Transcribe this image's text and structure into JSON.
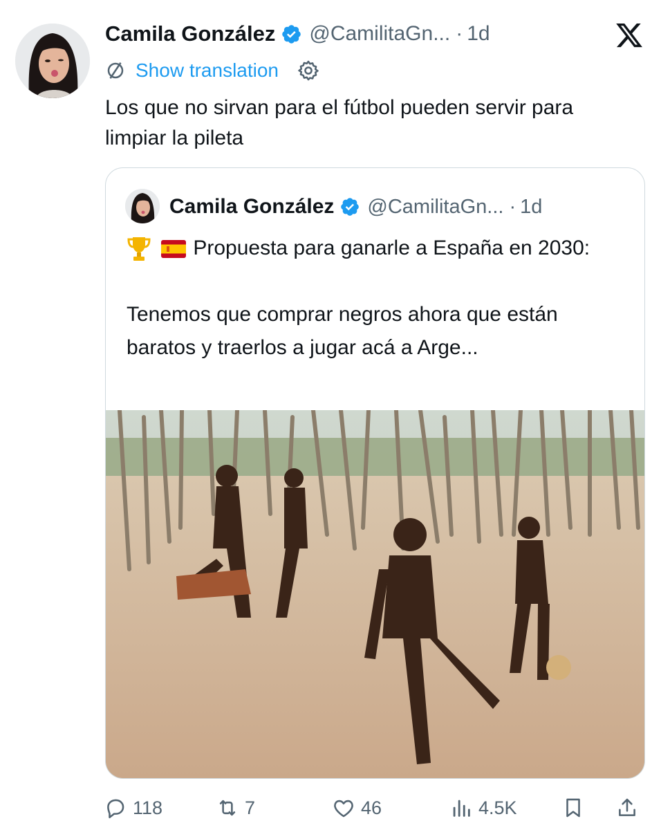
{
  "tweet": {
    "author_name": "Camila González",
    "handle": "@CamilitaGn...",
    "separator": "·",
    "time": "1d",
    "translate_label": "Show translation",
    "text": "Los que no sirvan para el fútbol pueden servir para limpiar la pileta"
  },
  "quoted": {
    "author_name": "Camila González",
    "handle": "@CamilitaGn...",
    "separator": "·",
    "time": "1d",
    "text_line1": "Propuesta para ganarle a España en 2030:",
    "text_line2": "Tenemos que comprar negros ahora que están baratos y traerlos a jugar acá a Arge...",
    "emojis": [
      "trophy-icon",
      "spain-flag-icon"
    ]
  },
  "actions": {
    "replies": "118",
    "reposts": "7",
    "likes": "46",
    "views": "4.5K"
  },
  "colors": {
    "accent": "#1d9bf0",
    "text": "#0f1419",
    "muted": "#536471",
    "border": "#cfd9de"
  }
}
